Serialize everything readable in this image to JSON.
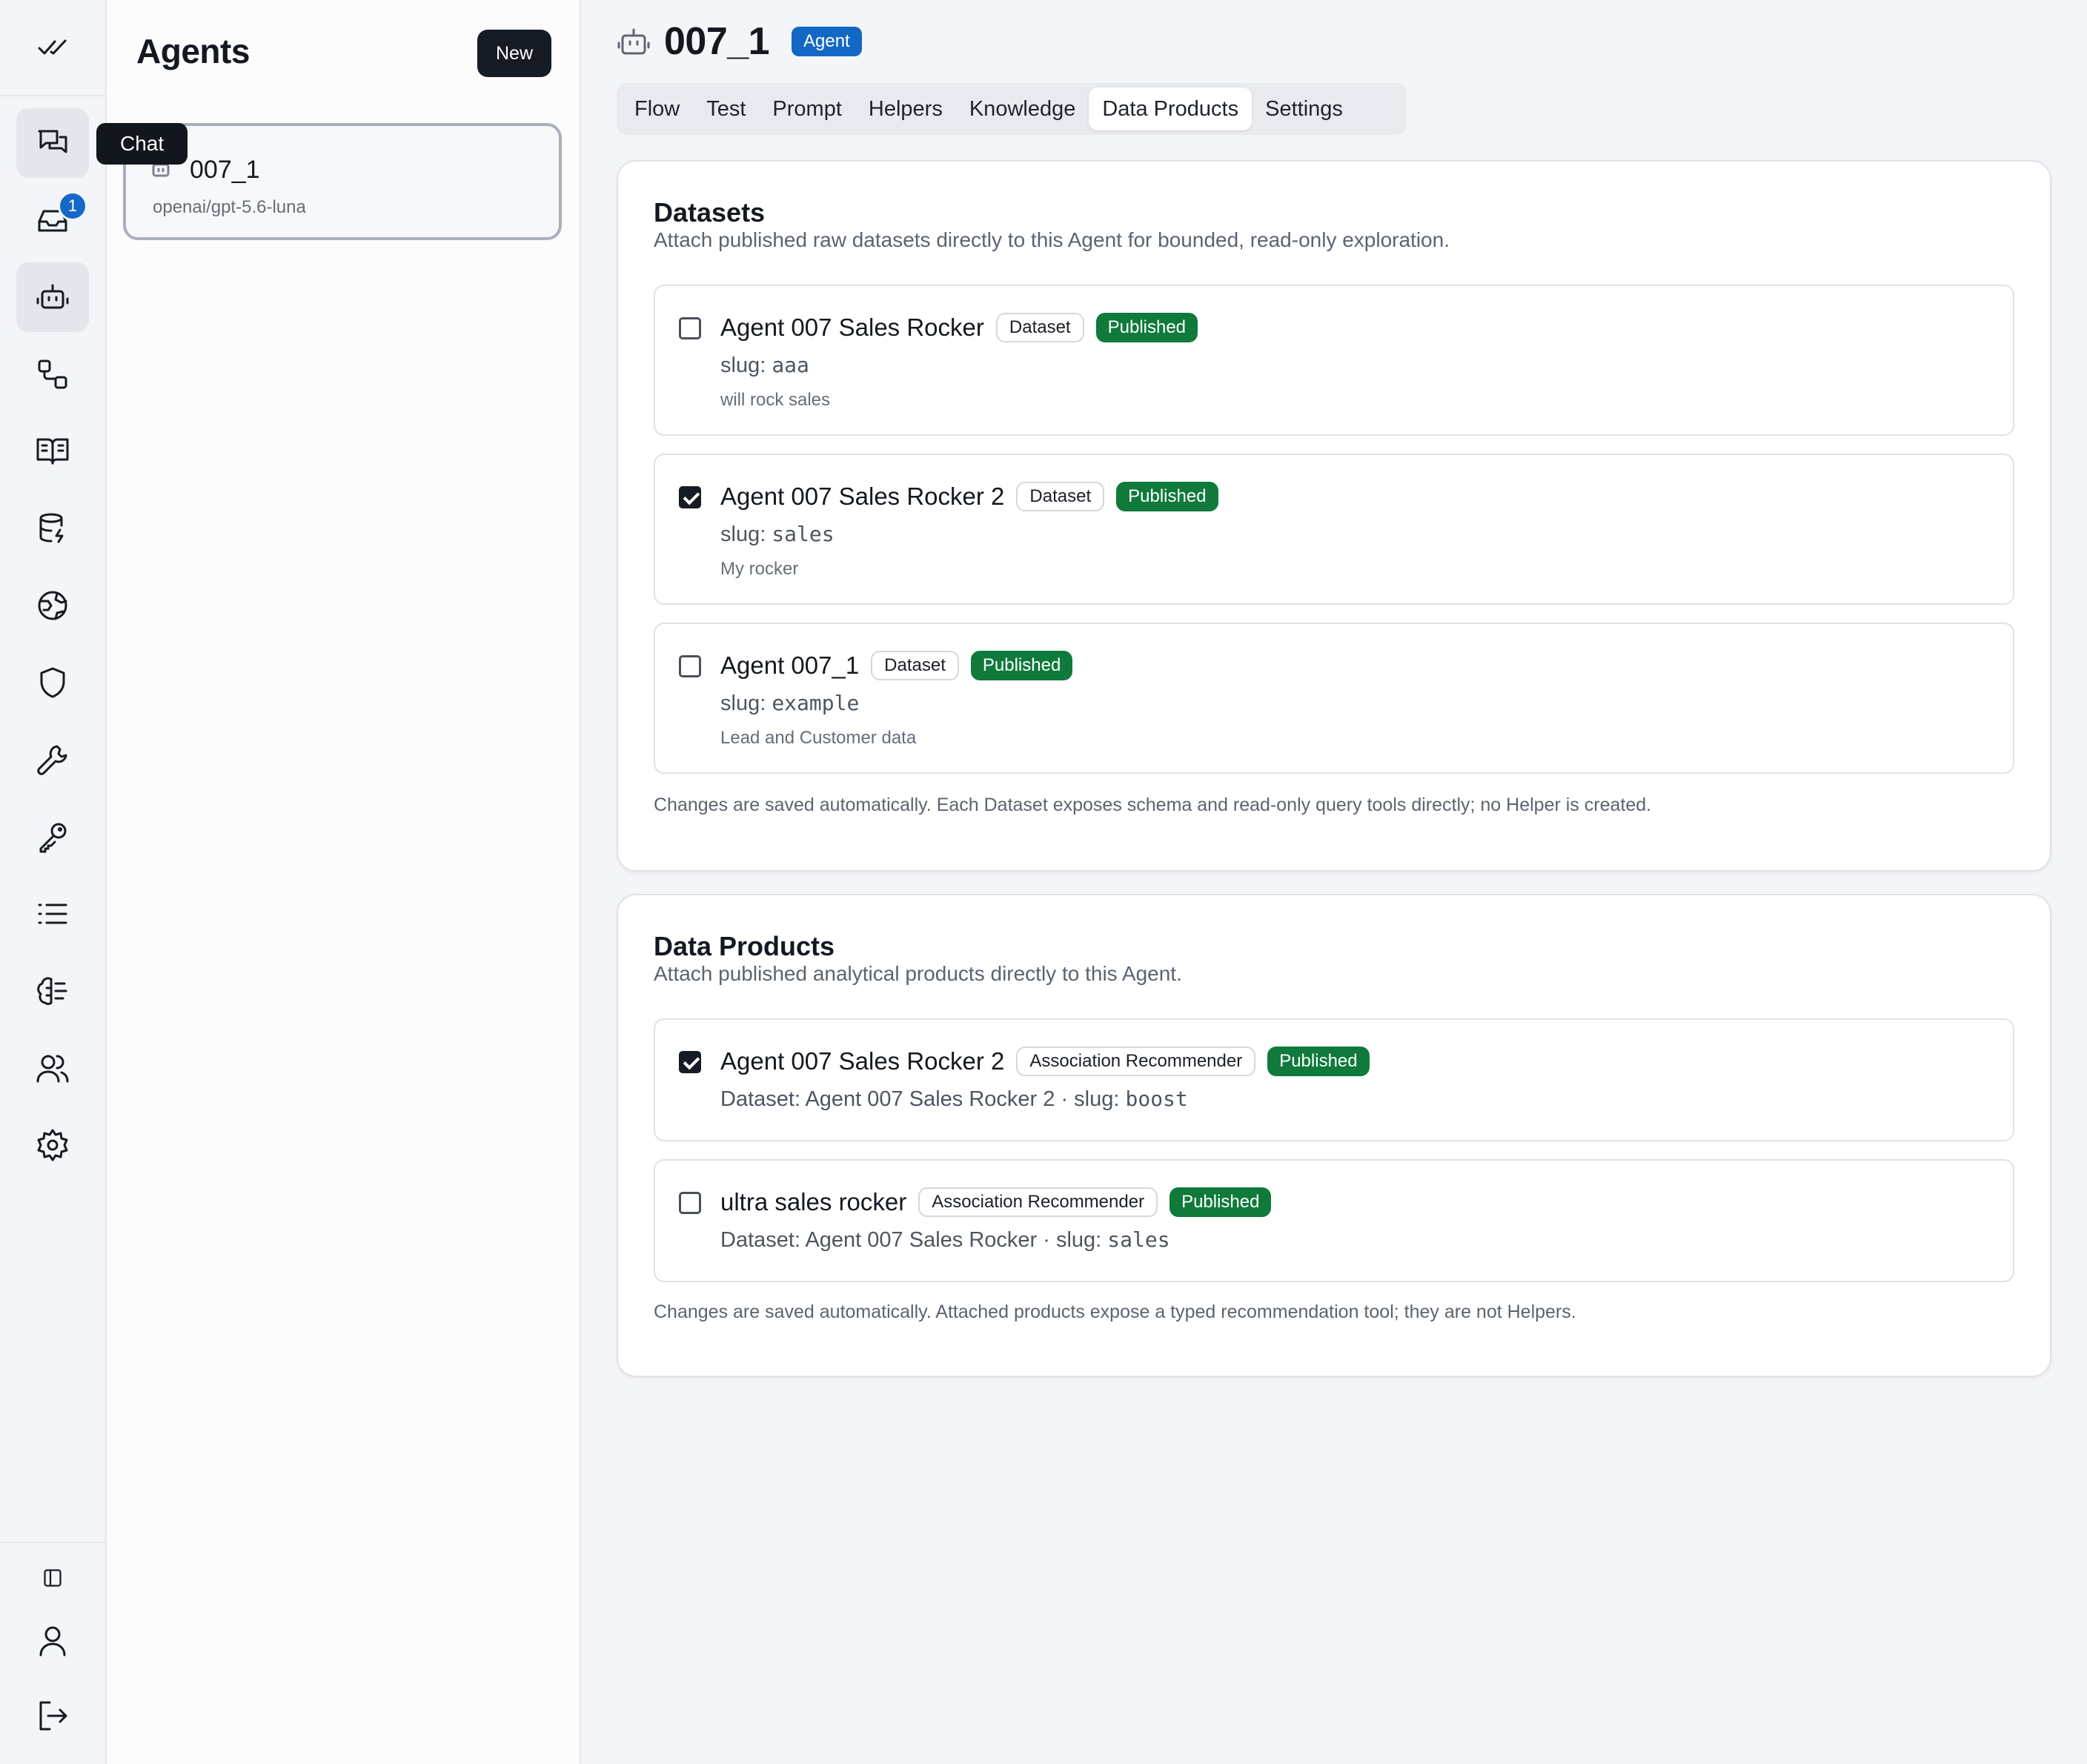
{
  "rail": {
    "tooltip": "Chat",
    "inbox_badge": "1",
    "icons": [
      "check-all-icon",
      "chat-icon",
      "inbox-icon",
      "bot-icon",
      "workflow-icon",
      "book-icon",
      "database-icon",
      "globe-icon",
      "shield-icon",
      "wrench-icon",
      "key-icon",
      "list-icon",
      "brain-icon",
      "users-icon",
      "gear-icon",
      "panel-icon",
      "user-icon",
      "logout-icon"
    ]
  },
  "agents_panel": {
    "title": "Agents",
    "new_label": "New",
    "agents": [
      {
        "name": "007_1",
        "model": "openai/gpt-5.6-luna"
      }
    ]
  },
  "header": {
    "title": "007_1",
    "type_badge": "Agent",
    "accent": "#1268c4"
  },
  "tabs": [
    {
      "label": "Flow",
      "active": false
    },
    {
      "label": "Test",
      "active": false
    },
    {
      "label": "Prompt",
      "active": false
    },
    {
      "label": "Helpers",
      "active": false
    },
    {
      "label": "Knowledge",
      "active": false
    },
    {
      "label": "Data Products",
      "active": true
    },
    {
      "label": "Settings",
      "active": false
    }
  ],
  "datasets": {
    "title": "Datasets",
    "description": "Attach published raw datasets directly to this Agent for bounded, read-only exploration.",
    "items": [
      {
        "name": "Agent 007 Sales Rocker",
        "type": "Dataset",
        "status": "Published",
        "slug_label": "slug:",
        "slug": "aaa",
        "note": "will rock sales",
        "checked": false
      },
      {
        "name": "Agent 007 Sales Rocker 2",
        "type": "Dataset",
        "status": "Published",
        "slug_label": "slug:",
        "slug": "sales",
        "note": "My rocker",
        "checked": true
      },
      {
        "name": "Agent 007_1",
        "type": "Dataset",
        "status": "Published",
        "slug_label": "slug:",
        "slug": "example",
        "note": "Lead and Customer data",
        "checked": false
      }
    ],
    "footer": "Changes are saved automatically. Each Dataset exposes schema and read-only query tools directly; no Helper is created."
  },
  "data_products": {
    "title": "Data Products",
    "description": "Attach published analytical products directly to this Agent.",
    "items": [
      {
        "name": "Agent 007 Sales Rocker 2",
        "type": "Association Recommender",
        "status": "Published",
        "dataset_text": "Dataset: Agent 007 Sales Rocker 2 · slug:",
        "slug": "boost",
        "checked": true
      },
      {
        "name": "ultra sales rocker",
        "type": "Association Recommender",
        "status": "Published",
        "dataset_text": "Dataset: Agent 007 Sales Rocker · slug:",
        "slug": "sales",
        "checked": false
      }
    ],
    "footer": "Changes are saved automatically. Attached products expose a typed recommendation tool; they are not Helpers."
  },
  "colors": {
    "published_green": "#0f7a3b",
    "primary_dark": "#161b24",
    "notification_blue": "#1668c9"
  }
}
